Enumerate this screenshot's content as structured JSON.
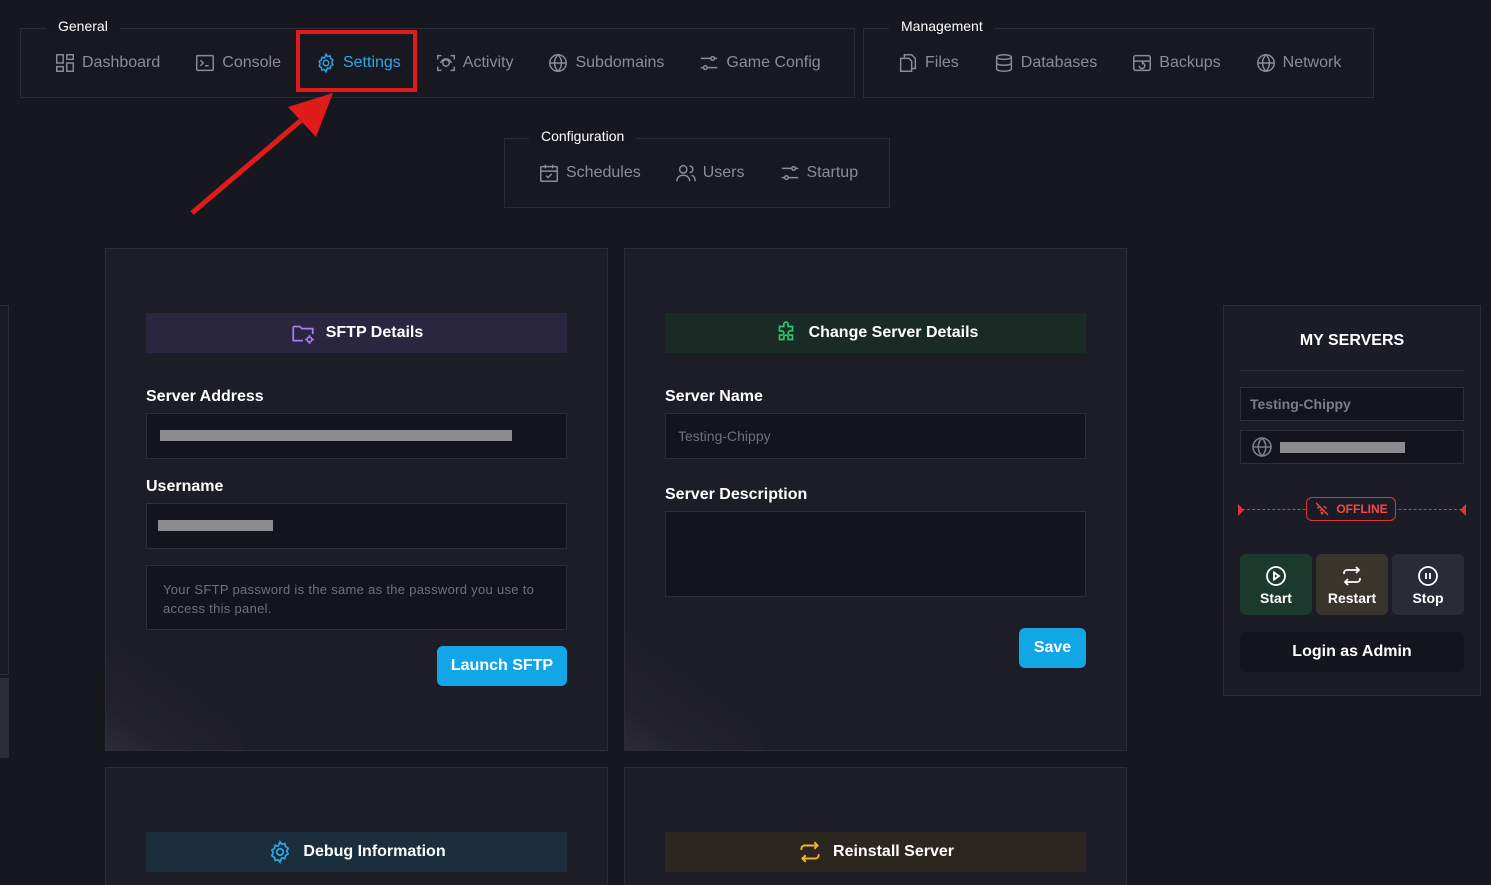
{
  "nav": {
    "general": {
      "title": "General",
      "items": [
        {
          "label": "Dashboard",
          "icon": "dashboard-icon"
        },
        {
          "label": "Console",
          "icon": "console-icon"
        },
        {
          "label": "Settings",
          "icon": "gear-icon",
          "active": true
        },
        {
          "label": "Activity",
          "icon": "activity-icon"
        },
        {
          "label": "Subdomains",
          "icon": "globe-icon"
        },
        {
          "label": "Game Config",
          "icon": "sliders-icon"
        }
      ]
    },
    "management": {
      "title": "Management",
      "items": [
        {
          "label": "Files",
          "icon": "files-icon"
        },
        {
          "label": "Databases",
          "icon": "database-icon"
        },
        {
          "label": "Backups",
          "icon": "backup-icon"
        },
        {
          "label": "Network",
          "icon": "globe-icon"
        }
      ]
    },
    "configuration": {
      "title": "Configuration",
      "items": [
        {
          "label": "Schedules",
          "icon": "calendar-icon"
        },
        {
          "label": "Users",
          "icon": "users-icon"
        },
        {
          "label": "Startup",
          "icon": "sliders-icon"
        }
      ]
    }
  },
  "sftp": {
    "title": "SFTP Details",
    "server_address_label": "Server Address",
    "username_label": "Username",
    "password_note": "Your SFTP password is the same as the password you use to access this panel.",
    "launch_button": "Launch SFTP"
  },
  "server_details": {
    "title": "Change Server Details",
    "name_label": "Server Name",
    "name_value": "Testing-Chippy",
    "description_label": "Server Description",
    "save_button": "Save"
  },
  "debug": {
    "title": "Debug Information"
  },
  "reinstall": {
    "title": "Reinstall Server"
  },
  "my_servers": {
    "title": "MY SERVERS",
    "server_name": "Testing-Chippy",
    "status": "OFFLINE",
    "start": "Start",
    "restart": "Restart",
    "stop": "Stop",
    "login_admin": "Login as Admin"
  },
  "colors": {
    "accent": "#12a6e6",
    "highlight": "#e01b1b",
    "offline": "#e03434",
    "sftp_header_bg": "#2b2640",
    "details_header_bg": "#1a2a25",
    "debug_header_bg": "#1a2e3c",
    "reinstall_header_bg": "#2c2620"
  }
}
